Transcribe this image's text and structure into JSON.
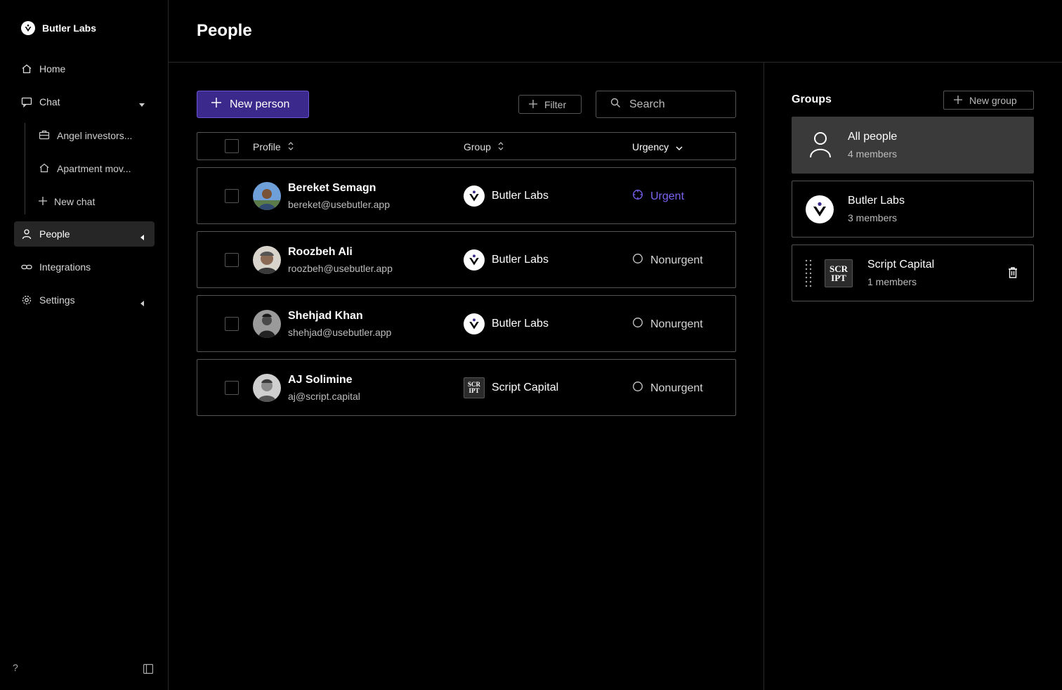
{
  "brand": {
    "name": "Butler Labs"
  },
  "nav": {
    "home": "Home",
    "chat": "Chat",
    "chat_items": [
      "Angel investors...",
      "Apartment mov...",
      "New chat"
    ],
    "people": "People",
    "integrations": "Integrations",
    "settings": "Settings"
  },
  "footer": {
    "help": "?"
  },
  "page": {
    "title": "People"
  },
  "toolbar": {
    "new_person": "New person",
    "filter": "Filter",
    "search_placeholder": "Search"
  },
  "table": {
    "headers": {
      "profile": "Profile",
      "group": "Group",
      "urgency": "Urgency"
    },
    "rows": [
      {
        "name": "Bereket Semagn",
        "email": "bereket@usebutler.app",
        "group": "Butler Labs",
        "urgency": "Urgent"
      },
      {
        "name": "Roozbeh Ali",
        "email": "roozbeh@usebutler.app",
        "group": "Butler Labs",
        "urgency": "Nonurgent"
      },
      {
        "name": "Shehjad Khan",
        "email": "shehjad@usebutler.app",
        "group": "Butler Labs",
        "urgency": "Nonurgent"
      },
      {
        "name": "AJ Solimine",
        "email": "aj@script.capital",
        "group": "Script Capital",
        "urgency": "Nonurgent"
      }
    ]
  },
  "groups": {
    "title": "Groups",
    "new_group": "New group",
    "items": [
      {
        "name": "All people",
        "count": "4 members"
      },
      {
        "name": "Butler Labs",
        "count": "3 members"
      },
      {
        "name": "Script Capital",
        "count": "1 members"
      }
    ]
  },
  "logos": {
    "script_top": "SCR",
    "script_bottom": "IPT"
  },
  "colors": {
    "accent": "#7c63f0",
    "primary_button": "#3b2a8c",
    "active_card": "#3a3a3a"
  }
}
